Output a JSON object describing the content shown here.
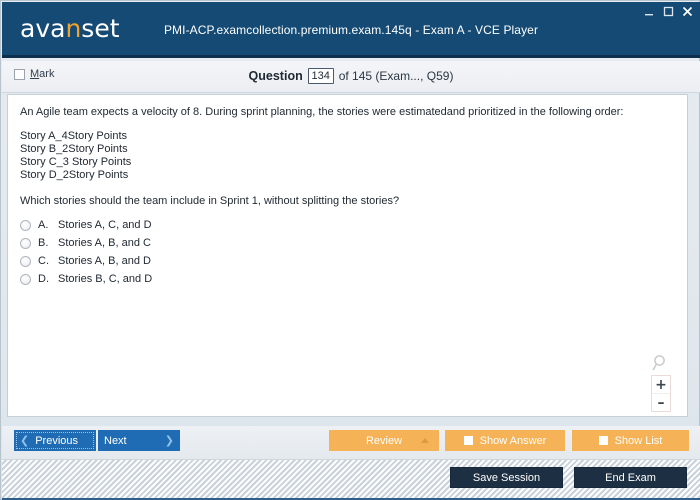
{
  "window": {
    "title": "PMI-ACP.examcollection.premium.exam.145q - Exam A - VCE Player",
    "logo_main_1": "ava",
    "logo_accent": "n",
    "logo_main_2": "set",
    "controls": {
      "minimize": "minimize-icon",
      "maximize": "maximize-icon",
      "close": "close-icon"
    },
    "colors": {
      "titlebar": "#154a74",
      "logo_accent": "#f0a22e",
      "primary_button": "#1f6cb5",
      "orange_button": "#f6b256",
      "dark_button": "#1d2f42"
    }
  },
  "statusbar": {
    "mark_label_underlined": "M",
    "mark_label_rest": "ark",
    "question_word": "Question",
    "question_number": "134",
    "question_of": "of 145 (Exam..., Q59)"
  },
  "question": {
    "stem": "An Agile team expects a velocity of 8. During sprint planning, the stories were estimatedand prioritized in the following order:",
    "story_lines": [
      "Story A_4Story Points",
      "Story B_2Story Points",
      "Story C_3 Story Points",
      "Story D_2Story Points"
    ],
    "prompt": "Which stories should the team include in Sprint 1, without splitting the stories?",
    "options": [
      {
        "letter": "A.",
        "text": "Stories A, C, and D",
        "selected": false
      },
      {
        "letter": "B.",
        "text": "Stories A, B, and C",
        "selected": false
      },
      {
        "letter": "C.",
        "text": "Stories A, B, and D",
        "selected": false
      },
      {
        "letter": "D.",
        "text": "Stories B, C, and D",
        "selected": false
      }
    ]
  },
  "zoom_widget": {
    "magnifier_icon": "magnifier-icon",
    "zoom_in": "+",
    "zoom_out": "–"
  },
  "toolbar": {
    "previous_label": "Previous",
    "next_label": "Next",
    "prev_chevron": "❮",
    "next_chevron": "❯",
    "review_label": "Review",
    "show_answer_label": "Show Answer",
    "show_list_label": "Show List"
  },
  "footer": {
    "save_session_label": "Save Session",
    "end_exam_label": "End Exam"
  }
}
